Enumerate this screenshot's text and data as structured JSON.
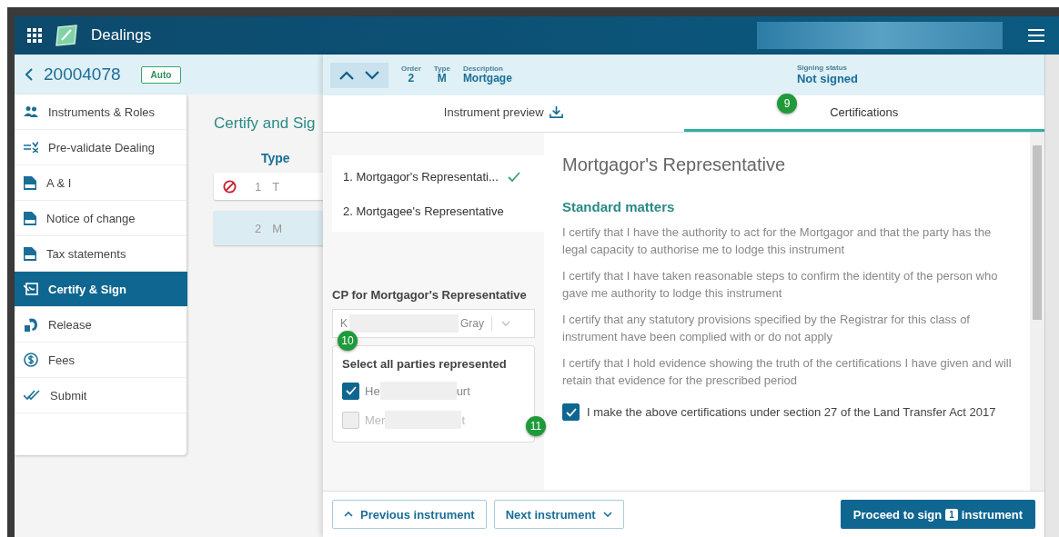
{
  "app_bar": {
    "title": "Dealings"
  },
  "dealing": {
    "number": "20004078",
    "badge": "Auto"
  },
  "nav": [
    {
      "label": "Instruments & Roles",
      "selected": false
    },
    {
      "label": "Pre-validate Dealing",
      "selected": false
    },
    {
      "label": "A & I",
      "selected": false
    },
    {
      "label": "Notice of change",
      "selected": false
    },
    {
      "label": "Tax statements",
      "selected": false
    },
    {
      "label": "Certify & Sign",
      "selected": true
    },
    {
      "label": "Release",
      "selected": false
    },
    {
      "label": "Fees",
      "selected": false
    },
    {
      "label": "Submit",
      "selected": false
    }
  ],
  "main": {
    "heading": "Certify and Sig",
    "column": "Type",
    "rows": [
      {
        "order": "1",
        "type": "T",
        "blocked": true,
        "selected": false
      },
      {
        "order": "2",
        "type": "M",
        "blocked": false,
        "selected": true
      }
    ]
  },
  "panel": {
    "order_label": "Order",
    "order": "2",
    "type_label": "Type",
    "type": "M",
    "description_label": "Description",
    "description": "Mortgage",
    "status_label": "Signing status",
    "status": "Not signed",
    "tabs": [
      {
        "label": "Instrument preview",
        "selected": false
      },
      {
        "label": "Certifications",
        "selected": true
      }
    ],
    "roles": [
      {
        "label": "1. Mortgagor's Representati...",
        "complete": true
      },
      {
        "label": "2. Mortgagee's Representative",
        "complete": false
      }
    ],
    "cp_label": "CP for Mortgagor's Representative",
    "cp_value_start": "K",
    "cp_value_end": "Gray",
    "parties_title": "Select all parties represented",
    "parties": [
      {
        "start": "He",
        "end": "urt",
        "checked": true
      },
      {
        "start": "Mer",
        "end": "t",
        "checked": false
      }
    ],
    "section_title": "Mortgagor's Representative",
    "subheading": "Standard matters",
    "certifications": [
      "I certify that I have the authority to act for the Mortgagor and that the party has the legal capacity to authorise me to lodge this instrument",
      "I certify that I have taken reasonable steps to confirm the identity of the person who gave me authority to lodge this instrument",
      "I certify that any statutory provisions specified by the Registrar for this class of instrument have been complied with or do not apply",
      "I certify that I hold evidence showing the truth of the certifications I have given and will retain that evidence for the prescribed period"
    ],
    "agreement": {
      "label": "I make the above certifications under section 27 of the Land Transfer Act 2017",
      "checked": true
    },
    "previous": "Previous instrument",
    "next": "Next instrument",
    "proceed": {
      "before": "Proceed to sign",
      "count": "1",
      "after": "instrument"
    }
  },
  "markers": [
    "9",
    "10",
    "11"
  ]
}
